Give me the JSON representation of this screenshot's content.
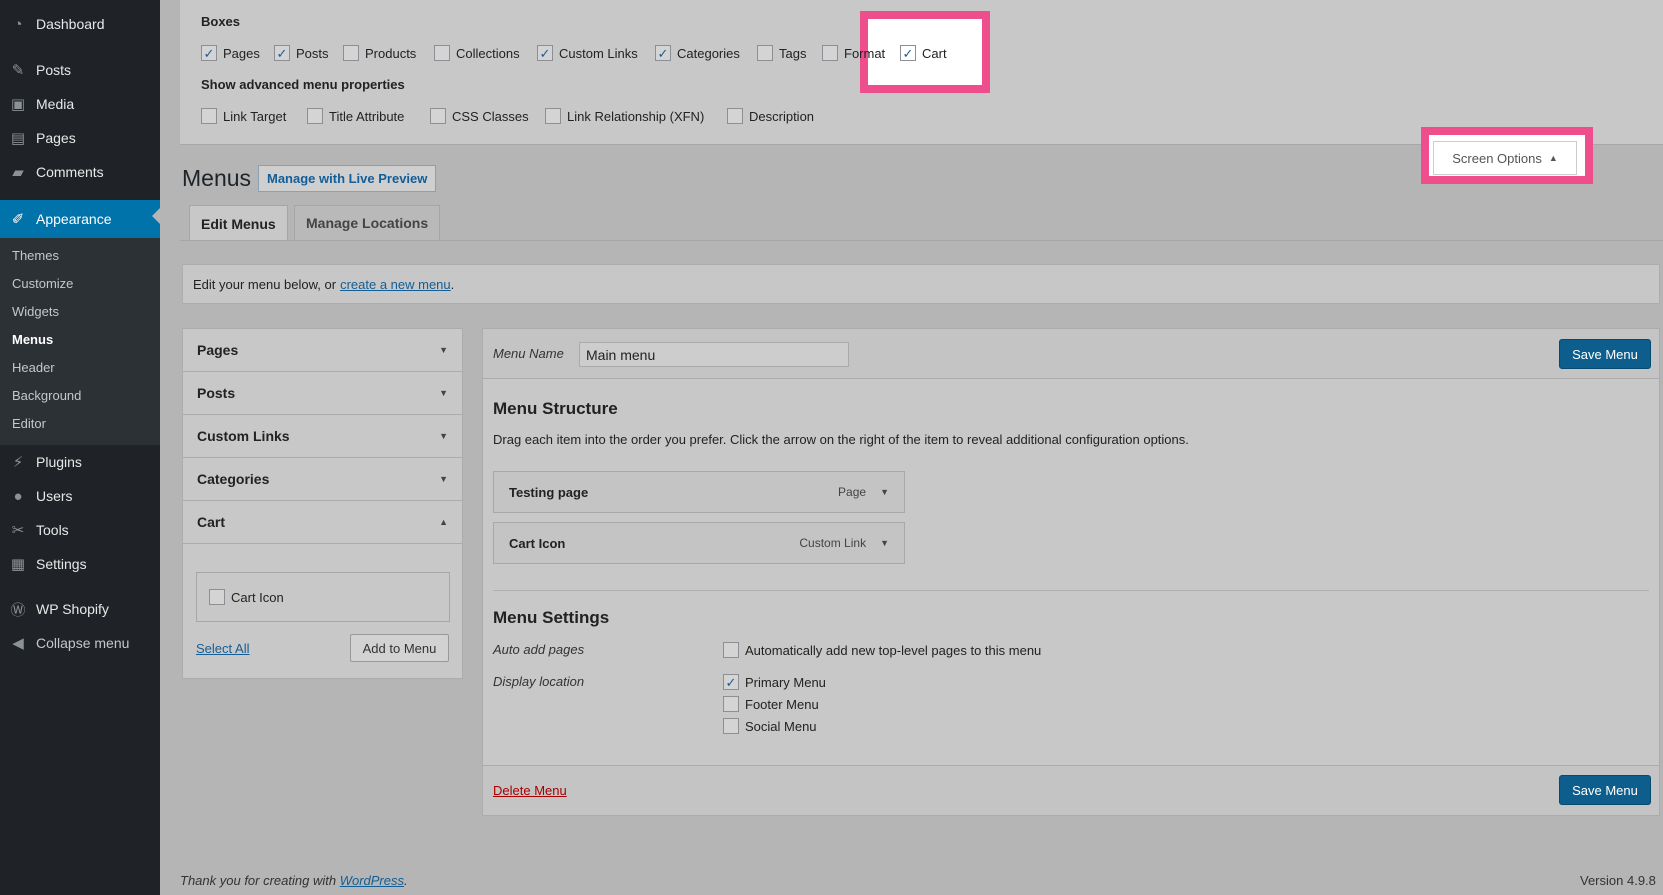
{
  "sidebar": {
    "items": [
      {
        "label": "Dashboard",
        "icon": "dashboard-icon",
        "glyph": "◔"
      },
      {
        "label": "Posts",
        "icon": "pin-icon",
        "glyph": "✎"
      },
      {
        "label": "Media",
        "icon": "media-icon",
        "glyph": "▣"
      },
      {
        "label": "Pages",
        "icon": "pages-icon",
        "glyph": "▤"
      },
      {
        "label": "Comments",
        "icon": "comment-icon",
        "glyph": "▰"
      },
      {
        "label": "Appearance",
        "icon": "brush-icon",
        "glyph": "✐"
      },
      {
        "label": "Plugins",
        "icon": "plug-icon",
        "glyph": "⚡"
      },
      {
        "label": "Users",
        "icon": "user-icon",
        "glyph": "●"
      },
      {
        "label": "Tools",
        "icon": "wrench-icon",
        "glyph": "✂"
      },
      {
        "label": "Settings",
        "icon": "settings-icon",
        "glyph": "▦"
      },
      {
        "label": "WP Shopify",
        "icon": "wordpress-icon",
        "glyph": "Ⓦ"
      },
      {
        "label": "Collapse menu",
        "icon": "collapse-icon",
        "glyph": "◀"
      }
    ],
    "submenu": [
      "Themes",
      "Customize",
      "Widgets",
      "Menus",
      "Header",
      "Background",
      "Editor"
    ]
  },
  "screen_options": {
    "boxes_heading": "Boxes",
    "boxes": [
      {
        "label": "Pages",
        "checked": true
      },
      {
        "label": "Posts",
        "checked": true
      },
      {
        "label": "Products",
        "checked": false
      },
      {
        "label": "Collections",
        "checked": false
      },
      {
        "label": "Custom Links",
        "checked": true
      },
      {
        "label": "Categories",
        "checked": true
      },
      {
        "label": "Tags",
        "checked": false
      },
      {
        "label": "Format",
        "checked": false
      },
      {
        "label": "Cart",
        "checked": true
      }
    ],
    "advanced_heading": "Show advanced menu properties",
    "advanced": [
      {
        "label": "Link Target",
        "checked": false
      },
      {
        "label": "Title Attribute",
        "checked": false
      },
      {
        "label": "CSS Classes",
        "checked": false
      },
      {
        "label": "Link Relationship (XFN)",
        "checked": false
      },
      {
        "label": "Description",
        "checked": false
      }
    ],
    "button_label": "Screen Options",
    "highlight_color": "#ee4f8c"
  },
  "header": {
    "title": "Menus",
    "live_preview": "Manage with Live Preview",
    "tabs": [
      "Edit Menus",
      "Manage Locations"
    ]
  },
  "notice": {
    "text": "Edit your menu below, or",
    "link": "create a new menu",
    "end": "."
  },
  "accordion": {
    "sections": [
      "Pages",
      "Posts",
      "Custom Links",
      "Categories",
      "Cart"
    ],
    "cart_item": "Cart Icon",
    "select_all": "Select All",
    "add_button": "Add to Menu"
  },
  "editor": {
    "menu_name_label": "Menu Name",
    "menu_name_value": "Main menu",
    "save_label": "Save Menu",
    "structure_title": "Menu Structure",
    "structure_desc": "Drag each item into the order you prefer. Click the arrow on the right of the item to reveal additional configuration options.",
    "items": [
      {
        "title": "Testing page",
        "type": "Page"
      },
      {
        "title": "Cart Icon",
        "type": "Custom Link"
      }
    ],
    "settings_title": "Menu Settings",
    "auto_add_label": "Auto add pages",
    "auto_add_option": "Automatically add new top-level pages to this menu",
    "display_label": "Display location",
    "locations": [
      {
        "label": "Primary Menu",
        "checked": true
      },
      {
        "label": "Footer Menu",
        "checked": false
      },
      {
        "label": "Social Menu",
        "checked": false
      }
    ],
    "delete_label": "Delete Menu"
  },
  "footer": {
    "thanks": "Thank you for creating with",
    "wp_link": "WordPress",
    "end": ".",
    "version": "Version 4.9.8"
  },
  "colors": {
    "accent": "#0073aa",
    "sidebar_bg": "#1f2327",
    "save_button": "#0d5e8c"
  }
}
